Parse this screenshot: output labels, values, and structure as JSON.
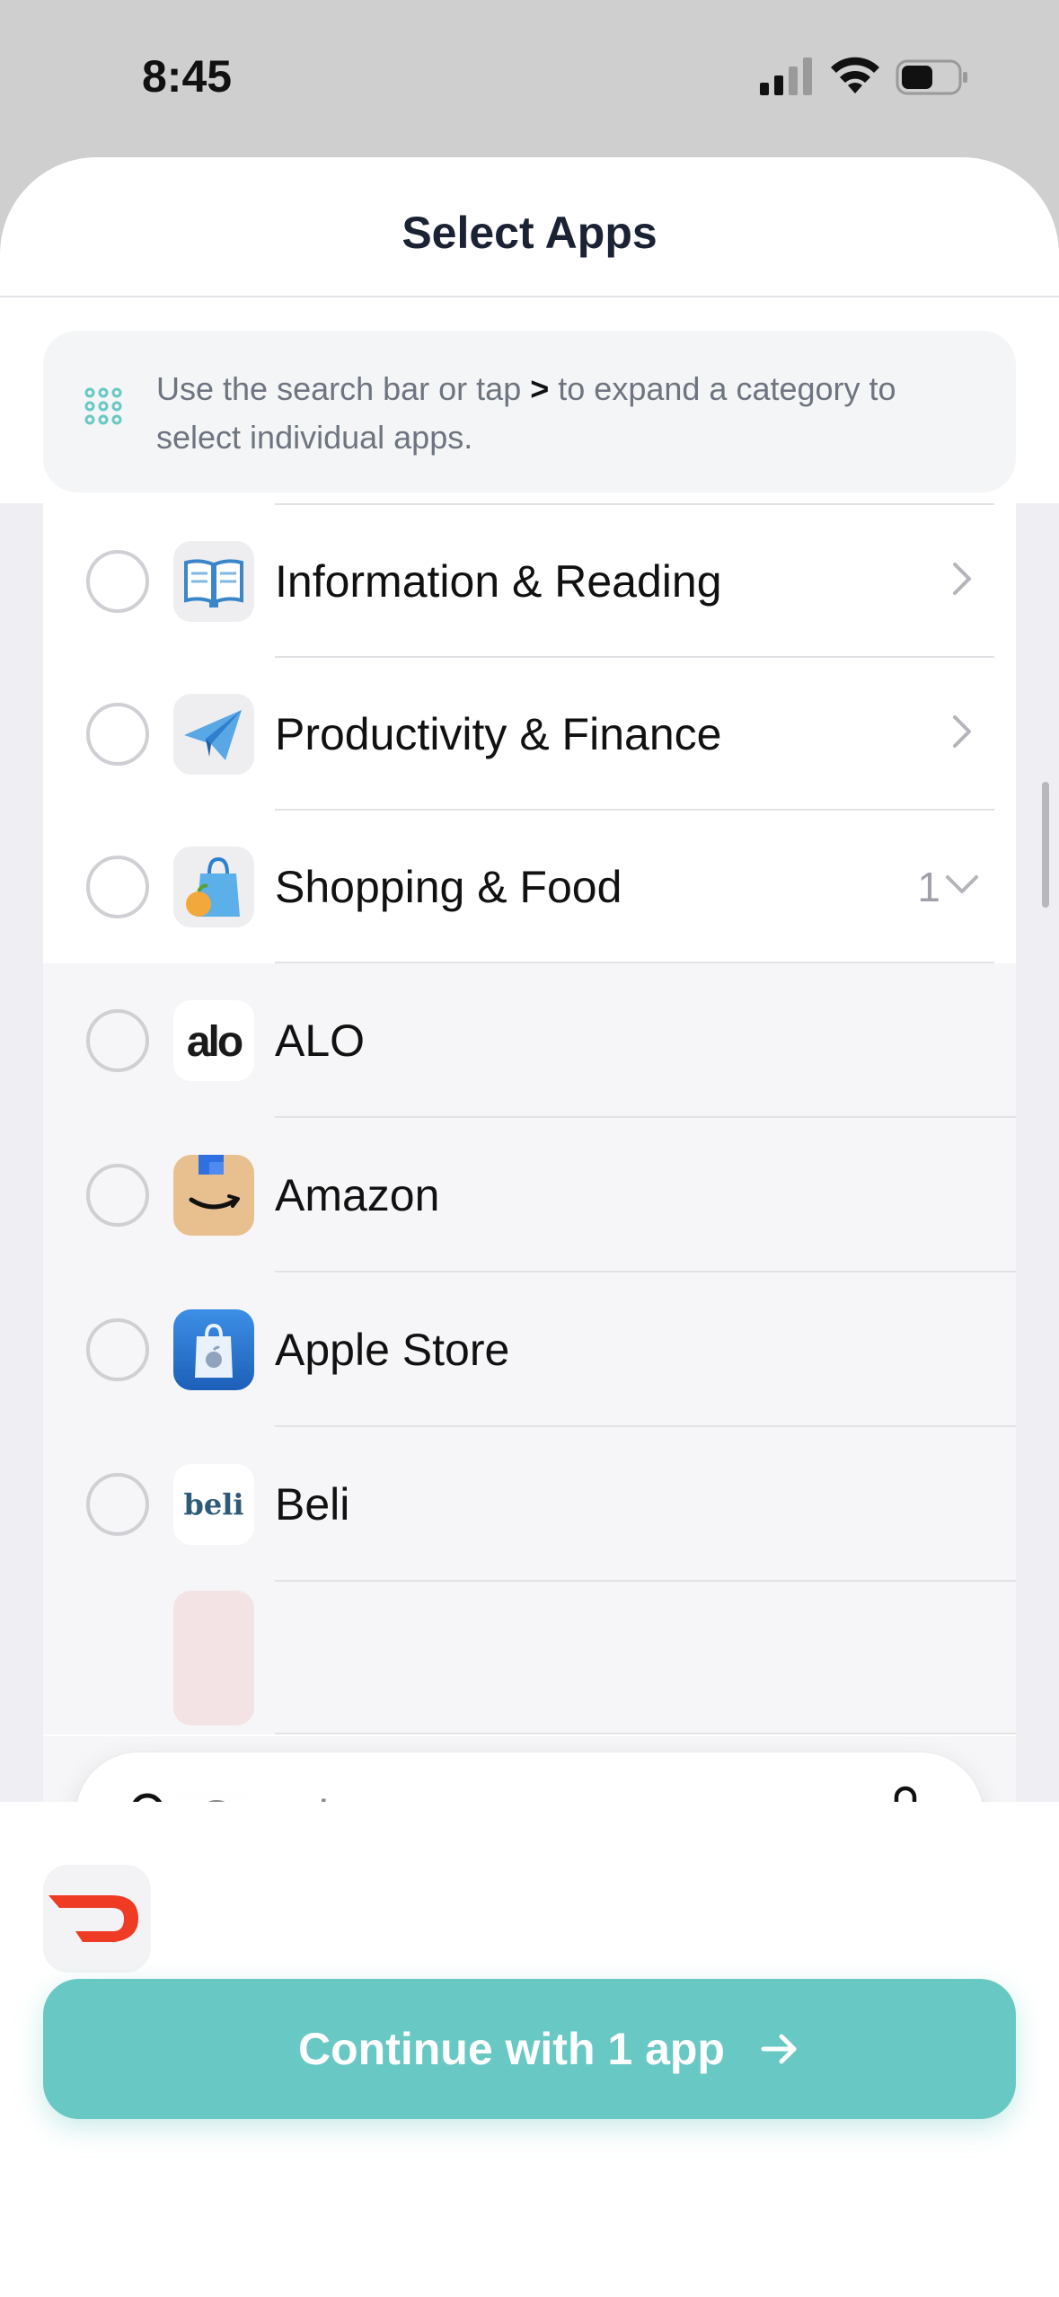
{
  "status_bar": {
    "time": "8:45"
  },
  "sheet": {
    "title": "Select Apps"
  },
  "hint": {
    "text_before": "Use the search bar or tap",
    "symbol": ">",
    "text_after": "to expand a category to select individual apps."
  },
  "categories": [
    {
      "label": "Information & Reading",
      "icon": "book-icon",
      "expanded": false
    },
    {
      "label": "Productivity & Finance",
      "icon": "paper-plane-icon",
      "expanded": false
    },
    {
      "label": "Shopping & Food",
      "icon": "shopping-bag-icon",
      "count": "1",
      "expanded": true
    }
  ],
  "apps": [
    {
      "label": "ALO",
      "icon": "alo-logo-icon"
    },
    {
      "label": "Amazon",
      "icon": "amazon-logo-icon"
    },
    {
      "label": "Apple Store",
      "icon": "apple-store-icon"
    },
    {
      "label": "Beli",
      "icon": "beli-logo-icon",
      "icon_text": "beli"
    }
  ],
  "search": {
    "placeholder": "Search"
  },
  "bottom": {
    "selected_app_icon": "doordash-logo-icon",
    "continue_label": "Continue with 1 app"
  },
  "colors": {
    "accent": "#68c8c4",
    "doordash": "#ef3b24"
  }
}
